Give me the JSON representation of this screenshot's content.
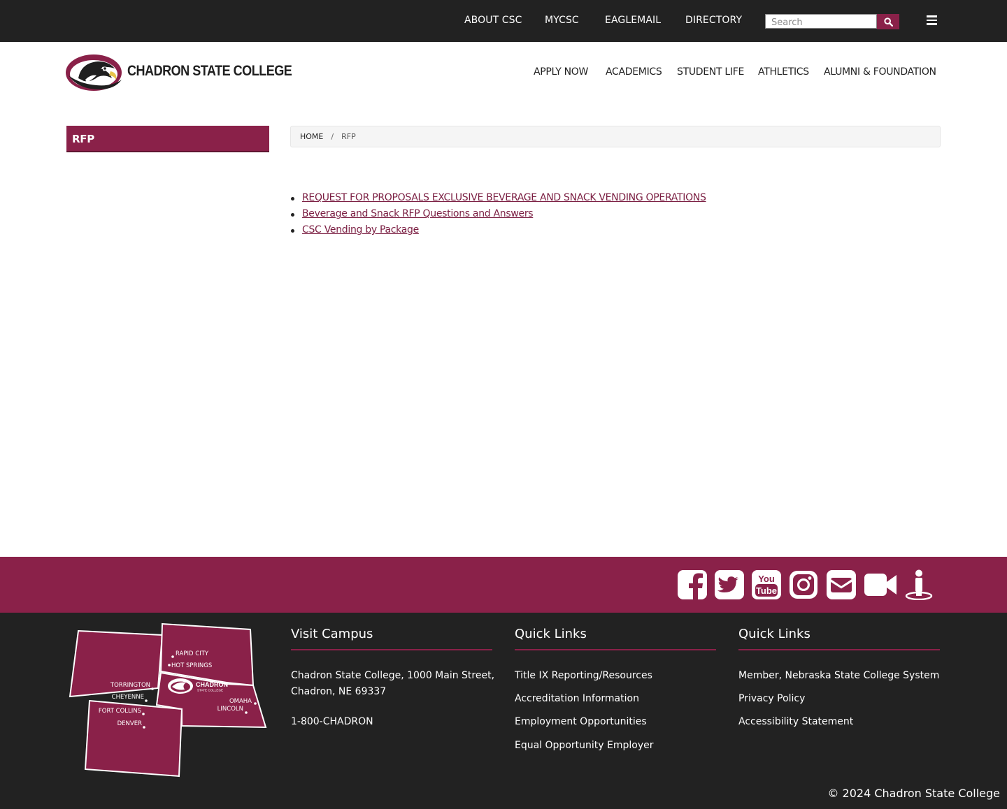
{
  "topbar": {
    "links": [
      "ABOUT CSC",
      "MYCSC",
      "EAGLEMAIL",
      "DIRECTORY"
    ],
    "search_placeholder": "Search"
  },
  "header": {
    "logo_text": "CHADRON STATE COLLEGE",
    "nav": [
      "APPLY NOW",
      "ACADEMICS",
      "STUDENT LIFE",
      "ATHLETICS",
      "ALUMNI & FOUNDATION"
    ]
  },
  "sidebar": {
    "title": "RFP"
  },
  "breadcrumb": {
    "home": "HOME",
    "separator": "/",
    "current": "RFP"
  },
  "main": {
    "documents": [
      "REQUEST FOR PROPOSALS EXCLUSIVE BEVERAGE AND SNACK VENDING OPERATIONS",
      "Beverage and Snack RFP Questions and Answers",
      "CSC Vending by Package"
    ]
  },
  "social": {
    "icons": [
      "facebook-icon",
      "twitter-icon",
      "youtube-icon",
      "instagram-icon",
      "email-icon",
      "video-icon",
      "person-info-icon"
    ],
    "youtube_text": [
      "You",
      "Tube"
    ]
  },
  "footer": {
    "map": {
      "labels": [
        "RAPID CITY",
        "HOT SPRINGS",
        "TORRINGTON",
        "CHEYENNE",
        "FORT COLLINS",
        "DENVER",
        "OMAHA",
        "LINCOLN"
      ],
      "logo_text": [
        "CHADRON",
        "STATE COLLEGE"
      ]
    },
    "visit": {
      "heading": "Visit Campus",
      "address_line1": "Chadron State College, 1000 Main Street,",
      "address_line2": "Chadron, NE 69337",
      "phone": "1-800-CHADRON"
    },
    "quick_links_1": {
      "heading": "Quick Links",
      "links": [
        "Title IX Reporting/Resources",
        "Accreditation Information",
        "Employment Opportunities",
        "Equal Opportunity Employer"
      ]
    },
    "quick_links_2": {
      "heading": "Quick Links",
      "links": [
        "Member, Nebraska State College System",
        "Privacy Policy",
        "Accessibility Statement"
      ]
    },
    "copyright": "© 2024 Chadron State College"
  },
  "colors": {
    "brand_maroon": "#8a2149",
    "dark_bar": "#222222",
    "link_maroon": "#7a1d41",
    "breadcrumb_bg": "#f5f5f5"
  }
}
